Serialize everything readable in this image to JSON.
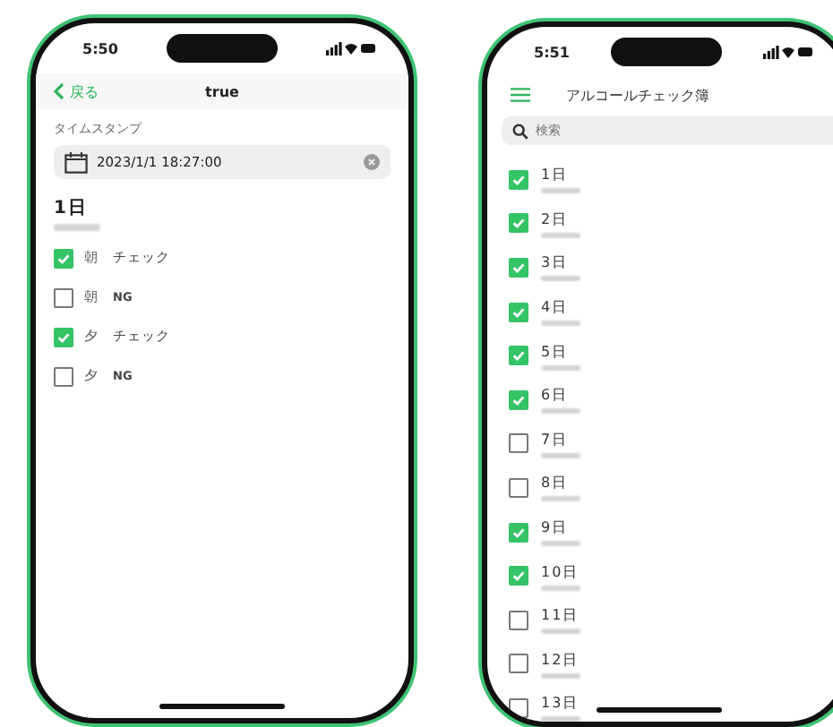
{
  "detail_screen": {
    "status_time": "5:50",
    "back_label": "戻る",
    "title": "true",
    "timestamp_label": "タイムスタンプ",
    "timestamp_value": "2023/1/1 18:27:00",
    "day_title": "1日",
    "checks": [
      {
        "period": "朝",
        "label": "チェック",
        "checked": true
      },
      {
        "period": "朝",
        "label": "NG",
        "checked": false
      },
      {
        "period": "夕",
        "label": "チェック",
        "checked": true
      },
      {
        "period": "夕",
        "label": "NG",
        "checked": false
      }
    ]
  },
  "list_screen": {
    "status_time": "5:51",
    "title": "アルコールチェック簿",
    "search": {
      "placeholder": "検索"
    },
    "days": [
      {
        "label": "1日",
        "checked": true
      },
      {
        "label": "2日",
        "checked": true
      },
      {
        "label": "3日",
        "checked": true
      },
      {
        "label": "4日",
        "checked": true
      },
      {
        "label": "5日",
        "checked": true
      },
      {
        "label": "6日",
        "checked": true
      },
      {
        "label": "7日",
        "checked": false
      },
      {
        "label": "8日",
        "checked": false
      },
      {
        "label": "9日",
        "checked": true
      },
      {
        "label": "10日",
        "checked": true
      },
      {
        "label": "11日",
        "checked": false
      },
      {
        "label": "12日",
        "checked": false
      },
      {
        "label": "13日",
        "checked": false
      }
    ]
  }
}
